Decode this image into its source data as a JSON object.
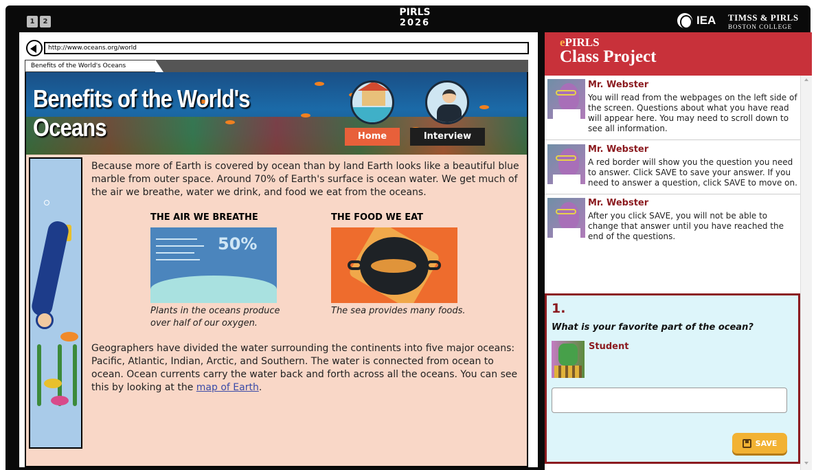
{
  "topbar": {
    "page_buttons": [
      "1",
      "2"
    ],
    "pirls_title": "PIRLS",
    "pirls_year": "2026",
    "iea_label": "IEA",
    "timss_line1": "TIMSS & PIRLS",
    "timss_line2": "BOSTON COLLEGE"
  },
  "browser": {
    "url": "http://www.oceans.org/world",
    "tab_label": "Benefits of the World's Oceans"
  },
  "site": {
    "banner_title_line1": "Benefits of the World's",
    "banner_title_line2": "Oceans",
    "nav": [
      {
        "label": "Home",
        "color": "#e8603a"
      },
      {
        "label": "Interview",
        "color": "#1e1e1e"
      }
    ],
    "intro": "Because more of Earth is covered by ocean than by land Earth looks like a beautiful blue marble from outer space. Around 70% of Earth's surface is ocean water. We get much of the air we breathe, water we drink, and food we eat from the oceans.",
    "air_heading": "THE AIR WE BREATHE",
    "air_percent": "50%",
    "air_caption_line1": "Plants in the oceans produce",
    "air_caption_line2": "over half of our oxygen.",
    "food_heading": "THE FOOD WE EAT",
    "food_caption": "The sea provides many foods.",
    "para2": "Geographers have divided the water surrounding the continents into five major oceans: Pacific, Atlantic, Indian, Arctic, and Southern. The water is connected from ocean to ocean. Ocean currents carry the water back and forth across all the oceans. You can see this by looking at the ",
    "map_link": "map of Earth",
    "para2_end": "."
  },
  "panel": {
    "epirls_e": "e",
    "epirls_rest": "PIRLS",
    "title": "Class Project",
    "messages": [
      {
        "name": "Mr. Webster",
        "text": "You will read from the webpages on the left side of the screen. Questions about what you have read will appear here. You may need to scroll down to see all information."
      },
      {
        "name": "Mr. Webster",
        "text": "A red border will show you the question you need to answer. Click SAVE to save your answer. If you need to answer a question, click SAVE to move on."
      },
      {
        "name": "Mr. Webster",
        "text": "After you click SAVE, you will not be able to change that answer until you have reached the end of the questions."
      }
    ],
    "question": {
      "number": "1.",
      "text": "What is your favorite part of the ocean?",
      "student_name": "Student",
      "answer_value": "",
      "save_label": "SAVE"
    }
  }
}
